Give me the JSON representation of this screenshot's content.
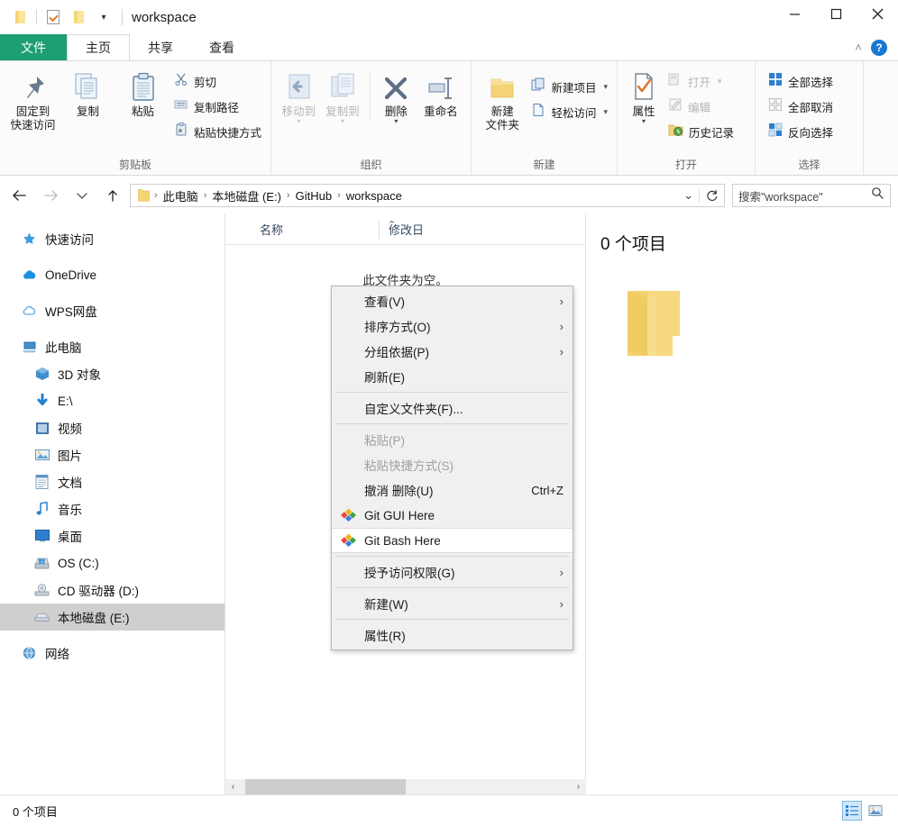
{
  "window": {
    "title": "workspace",
    "quick_access": [
      {
        "name": "folder-icon",
        "label": "folder"
      },
      {
        "name": "properties-check-icon",
        "label": "properties"
      },
      {
        "name": "folder-icon-2",
        "label": "new folder"
      },
      {
        "name": "customize-caret",
        "label": "▾"
      }
    ],
    "controls": {
      "minimize": "—",
      "maximize": "□",
      "close": "✕"
    }
  },
  "ribbon": {
    "tabs": [
      {
        "label": "文件",
        "id": "file",
        "style": "file"
      },
      {
        "label": "主页",
        "id": "home",
        "active": true
      },
      {
        "label": "共享",
        "id": "share"
      },
      {
        "label": "查看",
        "id": "view"
      }
    ],
    "collapse_chevron": "˄",
    "help_label": "?",
    "groups": [
      {
        "id": "clipboard",
        "label": "剪贴板",
        "big": [
          {
            "label": "固定到\n快速访问",
            "line1": "固定到",
            "line2": "快速访问",
            "icon": "pin-icon"
          },
          {
            "label": "复制",
            "line1": "复制",
            "line2": "",
            "icon": "copy-icon"
          },
          {
            "label": "粘贴",
            "line1": "粘贴",
            "line2": "",
            "icon": "paste-icon"
          }
        ],
        "small": [
          {
            "label": "剪切",
            "icon": "scissors-icon",
            "disabled": false
          },
          {
            "label": "复制路径",
            "icon": "copy-path-icon",
            "disabled": false
          },
          {
            "label": "粘贴快捷方式",
            "icon": "paste-shortcut-icon",
            "disabled": false
          }
        ]
      },
      {
        "id": "organize",
        "label": "组织",
        "big": [
          {
            "line1": "移动到",
            "line2": "",
            "icon": "move-to-icon",
            "disabled": true,
            "dropdown": true
          },
          {
            "line1": "复制到",
            "line2": "",
            "icon": "copy-to-icon",
            "disabled": true,
            "dropdown": true
          },
          {
            "line1": "删除",
            "line2": "",
            "icon": "delete-x-icon",
            "dropdown": true
          },
          {
            "line1": "重命名",
            "line2": "",
            "icon": "rename-icon"
          }
        ],
        "small": []
      },
      {
        "id": "new",
        "label": "新建",
        "big": [
          {
            "line1": "新建",
            "line2": "文件夹",
            "icon": "new-folder-icon"
          }
        ],
        "small": [
          {
            "label": "新建项目",
            "icon": "new-item-icon",
            "dropdown": true
          },
          {
            "label": "轻松访问",
            "icon": "easy-access-icon",
            "dropdown": true
          }
        ]
      },
      {
        "id": "open",
        "label": "打开",
        "big": [
          {
            "line1": "属性",
            "line2": "",
            "icon": "properties-icon",
            "dropdown": true
          }
        ],
        "small": [
          {
            "label": "打开",
            "icon": "open-icon",
            "disabled": true,
            "dropdown": true
          },
          {
            "label": "编辑",
            "icon": "edit-icon",
            "disabled": true
          },
          {
            "label": "历史记录",
            "icon": "history-icon"
          }
        ]
      },
      {
        "id": "select",
        "label": "选择",
        "big": [],
        "small": [
          {
            "label": "全部选择",
            "icon": "select-all-icon"
          },
          {
            "label": "全部取消",
            "icon": "select-none-icon"
          },
          {
            "label": "反向选择",
            "icon": "invert-selection-icon"
          }
        ]
      }
    ]
  },
  "address": {
    "back_icon": "back-arrow-icon",
    "forward_icon": "forward-arrow-icon",
    "recent_icon": "recent-locations-icon",
    "up_icon": "up-arrow-icon",
    "breadcrumbs": [
      "此电脑",
      "本地磁盘 (E:)",
      "GitHub",
      "workspace"
    ],
    "separator": "›",
    "dropdown_caret": "⌄",
    "refresh_icon": "refresh-icon",
    "search_placeholder": "搜索\"workspace\""
  },
  "nav_pane": {
    "items": [
      {
        "label": "快速访问",
        "icon": "star-pin-icon",
        "indent": false
      },
      {
        "gap": true
      },
      {
        "label": "OneDrive",
        "icon": "onedrive-cloud-icon",
        "indent": false
      },
      {
        "gap": true
      },
      {
        "label": "WPS网盘",
        "icon": "wps-cloud-icon",
        "indent": false
      },
      {
        "gap": true
      },
      {
        "label": "此电脑",
        "icon": "this-pc-icon",
        "indent": false
      },
      {
        "label": "3D 对象",
        "icon": "3d-objects-icon",
        "indent": true
      },
      {
        "label": "E:\\",
        "icon": "downloads-icon",
        "indent": true
      },
      {
        "label": "视频",
        "icon": "videos-icon",
        "indent": true
      },
      {
        "label": "图片",
        "icon": "pictures-icon",
        "indent": true
      },
      {
        "label": "文档",
        "icon": "documents-icon",
        "indent": true
      },
      {
        "label": "音乐",
        "icon": "music-icon",
        "indent": true
      },
      {
        "label": "桌面",
        "icon": "desktop-icon",
        "indent": true
      },
      {
        "label": "OS (C:)",
        "icon": "os-drive-icon",
        "indent": true
      },
      {
        "label": "CD 驱动器 (D:)",
        "icon": "cd-drive-icon",
        "indent": true
      },
      {
        "label": "本地磁盘 (E:)",
        "icon": "local-disk-icon",
        "indent": true,
        "selected": true
      },
      {
        "gap": true
      },
      {
        "label": "网络",
        "icon": "network-icon",
        "indent": false
      }
    ]
  },
  "file_list": {
    "columns": [
      {
        "label": "名称",
        "sorted": true,
        "sort_caret": "⌃"
      },
      {
        "label": "修改日"
      }
    ],
    "empty_message": "此文件夹为空。",
    "scrollbar": {
      "left_arrow": "‹",
      "right_arrow": "›"
    }
  },
  "detail_pane": {
    "title": "0 个项目",
    "icon": "large-folder-icon"
  },
  "status_bar": {
    "item_count": "0 个项目",
    "view_buttons": [
      {
        "name": "details-view-button",
        "active": true
      },
      {
        "name": "large-icons-view-button",
        "active": false
      }
    ]
  },
  "context_menu": {
    "items": [
      {
        "label": "查看(V)",
        "submenu": true
      },
      {
        "label": "排序方式(O)",
        "submenu": true
      },
      {
        "label": "分组依据(P)",
        "submenu": true
      },
      {
        "label": "刷新(E)"
      },
      {
        "separator": true
      },
      {
        "label": "自定义文件夹(F)..."
      },
      {
        "separator": true
      },
      {
        "label": "粘贴(P)",
        "disabled": true
      },
      {
        "label": "粘贴快捷方式(S)",
        "disabled": true
      },
      {
        "label": "撤消 删除(U)",
        "accel": "Ctrl+Z"
      },
      {
        "label": "Git GUI Here",
        "icon": "git-icon"
      },
      {
        "label": "Git Bash Here",
        "icon": "git-icon",
        "hovered": true
      },
      {
        "separator": true
      },
      {
        "label": "授予访问权限(G)",
        "submenu": true
      },
      {
        "separator": true
      },
      {
        "label": "新建(W)",
        "submenu": true
      },
      {
        "separator": true
      },
      {
        "label": "属性(R)"
      }
    ],
    "submenu_glyph": "›"
  },
  "colors": {
    "file_tab_green": "#1d9e74",
    "folder_yellow": "#f6d472",
    "selection_gray": "#cfcfcf",
    "accent_blue": "#1878d4"
  }
}
